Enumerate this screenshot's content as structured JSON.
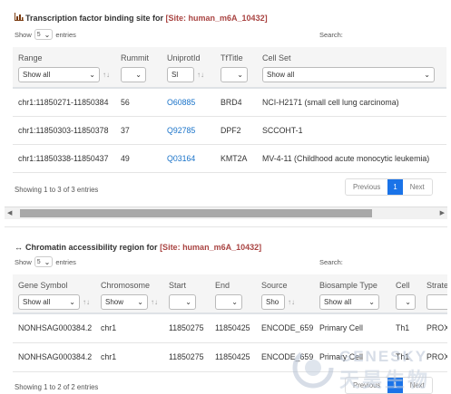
{
  "tfbs": {
    "title_prefix": "Transcription factor binding site for",
    "site": "[Site: human_m6A_10432]",
    "icon": "bar-chart-icon",
    "show_label": "Show",
    "length_value": "5",
    "entries_label": "entries",
    "search_label": "Search:",
    "columns": [
      {
        "label": "Range",
        "filter": "Show all"
      },
      {
        "label": "Rummit",
        "filter": ""
      },
      {
        "label": "UniprotId",
        "filter": "Sl"
      },
      {
        "label": "TfTitle",
        "filter": ""
      },
      {
        "label": "Cell Set",
        "filter": "Show all"
      }
    ],
    "rows": [
      [
        "chr1:11850271-11850384",
        "56",
        "O60885",
        "BRD4",
        "NCI-H2171 (small cell lung carcinoma)"
      ],
      [
        "chr1:11850303-11850378",
        "37",
        "Q92785",
        "DPF2",
        "SCCOHT-1"
      ],
      [
        "chr1:11850338-11850437",
        "49",
        "Q03164",
        "KMT2A",
        "MV-4-11 (Childhood acute monocytic leukemia)"
      ]
    ],
    "info": "Showing 1 to 3 of 3 entries",
    "pager": {
      "previous": "Previous",
      "current": "1",
      "next": "Next"
    }
  },
  "car": {
    "title_prefix": "Chromatin accessibility region for",
    "site": "[Site: human_m6A_10432]",
    "icon": "left-right-arrow-icon",
    "show_label": "Show",
    "length_value": "5",
    "entries_label": "entries",
    "search_label": "Search:",
    "columns": [
      {
        "label": "Gene Symbol",
        "filter": "Show all"
      },
      {
        "label": "Chromosome",
        "filter": "Show"
      },
      {
        "label": "Start",
        "filter": ""
      },
      {
        "label": "End",
        "filter": ""
      },
      {
        "label": "Source",
        "filter": "Sho"
      },
      {
        "label": "Biosample Type",
        "filter": "Show all"
      },
      {
        "label": "Cell",
        "filter": ""
      },
      {
        "label": "Strate",
        "filter": ""
      }
    ],
    "rows": [
      [
        "NONHSAG000384.2",
        "chr1",
        "11850275",
        "11850425",
        "ENCODE_659",
        "Primary Cell",
        "Th1",
        "PROX"
      ],
      [
        "NONHSAG000384.2",
        "chr1",
        "11850275",
        "11850425",
        "ENCODE_659",
        "Primary Cell",
        "Th1",
        "PROX"
      ]
    ],
    "info": "Showing 1 to 2 of 2 entries",
    "pager": {
      "previous": "Previous",
      "current": "1",
      "next": "Next"
    }
  },
  "watermark": {
    "en": "GENESKY",
    "cn": "天昊生物"
  },
  "colors": {
    "site": "#a94442",
    "link": "#1a73c9",
    "active_page": "#1a73e8"
  }
}
